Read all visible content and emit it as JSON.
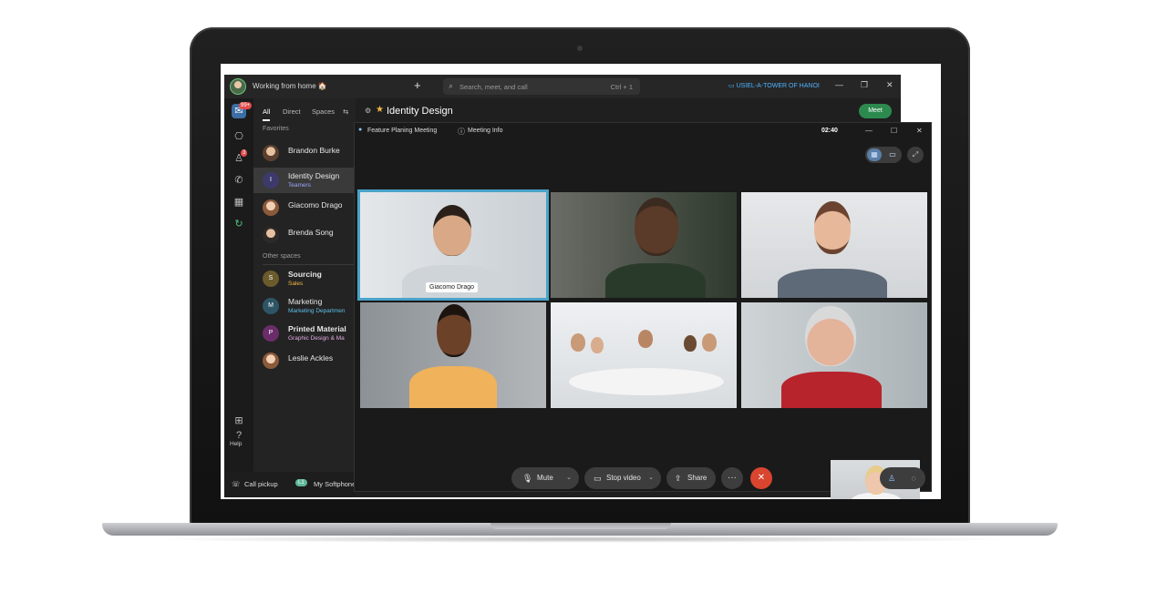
{
  "app": {
    "status_text": "Working from home 🏠",
    "search_placeholder": "Search, meet, and call",
    "search_shortcut": "Ctrl + 1",
    "location": "USIEL-A-TOWER OF HANOI",
    "rail_badge_messages": "99+",
    "rail_badge_contacts": "3",
    "help_label": "Help"
  },
  "list": {
    "tabs": [
      "All",
      "Direct",
      "Spaces"
    ],
    "favorites_label": "Favorites",
    "other_spaces_label": "Other spaces",
    "favorites": [
      {
        "name": "Brandon Burke",
        "sub": "",
        "initial": ""
      },
      {
        "name": "Identity Design",
        "sub": "Teamers",
        "initial": "I"
      },
      {
        "name": "Giacomo Drago",
        "sub": "",
        "initial": ""
      },
      {
        "name": "Brenda Song",
        "sub": "",
        "initial": ""
      }
    ],
    "others": [
      {
        "name": "Sourcing",
        "sub": "Sales",
        "initial": "S"
      },
      {
        "name": "Marketing",
        "sub": "Marketing Departmen",
        "initial": "M"
      },
      {
        "name": "Printed Material",
        "sub": "Graphic Design & Ma",
        "initial": "P"
      },
      {
        "name": "Leslie Ackles",
        "sub": "",
        "initial": ""
      }
    ]
  },
  "bottom": {
    "call_pickup": "Call pickup",
    "softphone_badge": "L1",
    "softphone": "My Softphone"
  },
  "space": {
    "title": "Identity Design",
    "meet_label": "Meet"
  },
  "meeting": {
    "title": "Feature Planing Meeting",
    "info_label": "Meeting Info",
    "timer": "02:40",
    "active_speaker_name": "Giacomo Drago",
    "controls": {
      "mute": "Mute",
      "stop_video": "Stop video",
      "share": "Share",
      "more": "···"
    }
  },
  "colors": {
    "accent_blue": "#3b6ea5",
    "meet_green": "#2d8a4e",
    "end_call_red": "#d9452f",
    "active_tile_border": "#4aa3c9"
  }
}
